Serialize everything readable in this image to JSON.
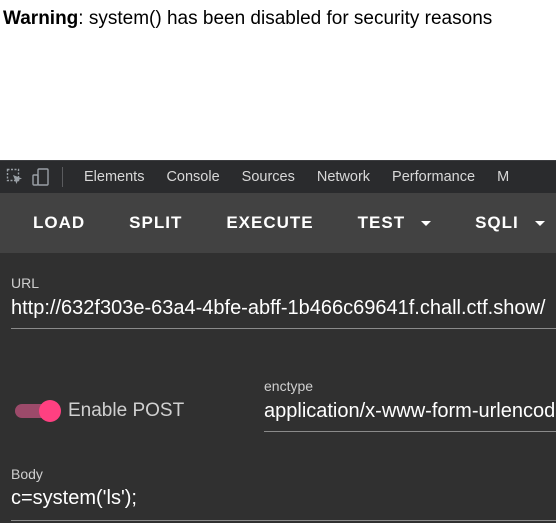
{
  "page": {
    "warning_bold": "Warning",
    "warning_rest": ": system() has been disabled for security reasons"
  },
  "devtools": {
    "tabs": [
      "Elements",
      "Console",
      "Sources",
      "Network",
      "Performance",
      "M"
    ],
    "icons": [
      "inspect-element-icon",
      "device-toggle-icon"
    ]
  },
  "hackbar": {
    "buttons": {
      "load": "LOAD",
      "split": "SPLIT",
      "execute": "EXECUTE",
      "test": "TEST",
      "sqli": "SQLI"
    },
    "url_label": "URL",
    "url_value": "http://632f303e-63a4-4bfe-abff-1b466c69641f.chall.ctf.show/",
    "enable_post_label": "Enable POST",
    "enable_post_on": true,
    "enctype_label": "enctype",
    "enctype_value": "application/x-www-form-urlencoded",
    "body_label": "Body",
    "body_value": "c=system('ls');"
  },
  "colors": {
    "toolbar_bg": "#424242",
    "panel_bg": "#303030",
    "devtools_bg": "#2a2b2d",
    "toggle_accent": "#ff4081"
  }
}
